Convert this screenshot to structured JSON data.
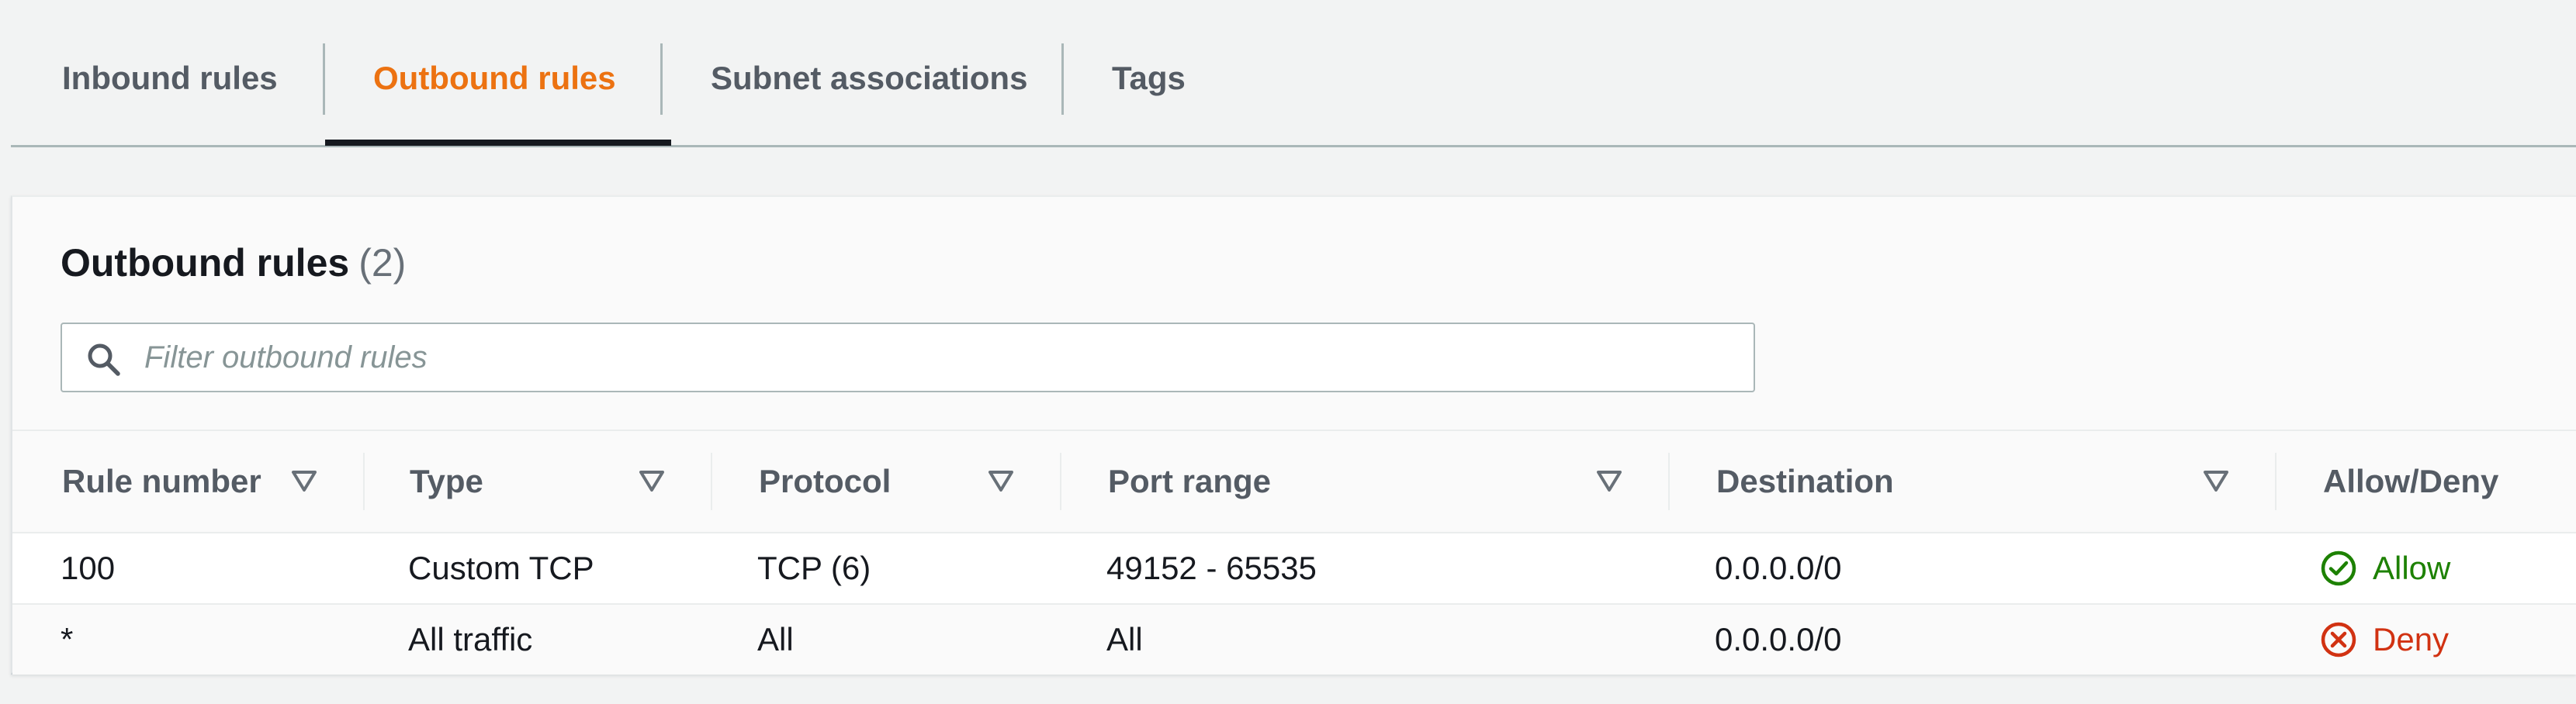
{
  "tabs": [
    {
      "label": "Inbound rules"
    },
    {
      "label": "Outbound rules"
    },
    {
      "label": "Subnet associations"
    },
    {
      "label": "Tags"
    }
  ],
  "panel": {
    "title": "Outbound rules",
    "count": "(2)"
  },
  "search": {
    "placeholder": "Filter outbound rules",
    "value": "",
    "icon": "search-icon"
  },
  "table": {
    "columns": [
      {
        "label": "Rule number"
      },
      {
        "label": "Type"
      },
      {
        "label": "Protocol"
      },
      {
        "label": "Port range"
      },
      {
        "label": "Destination"
      },
      {
        "label": "Allow/Deny"
      }
    ],
    "rows": [
      {
        "rule_number": "100",
        "type": "Custom TCP",
        "protocol": "TCP (6)",
        "port_range": "49152 - 65535",
        "destination": "0.0.0.0/0",
        "action": "Allow"
      },
      {
        "rule_number": "*",
        "type": "All traffic",
        "protocol": "All",
        "port_range": "All",
        "destination": "0.0.0.0/0",
        "action": "Deny"
      }
    ]
  },
  "colors": {
    "accent": "#ec7211",
    "allow": "#1d8102",
    "deny": "#d13212"
  }
}
